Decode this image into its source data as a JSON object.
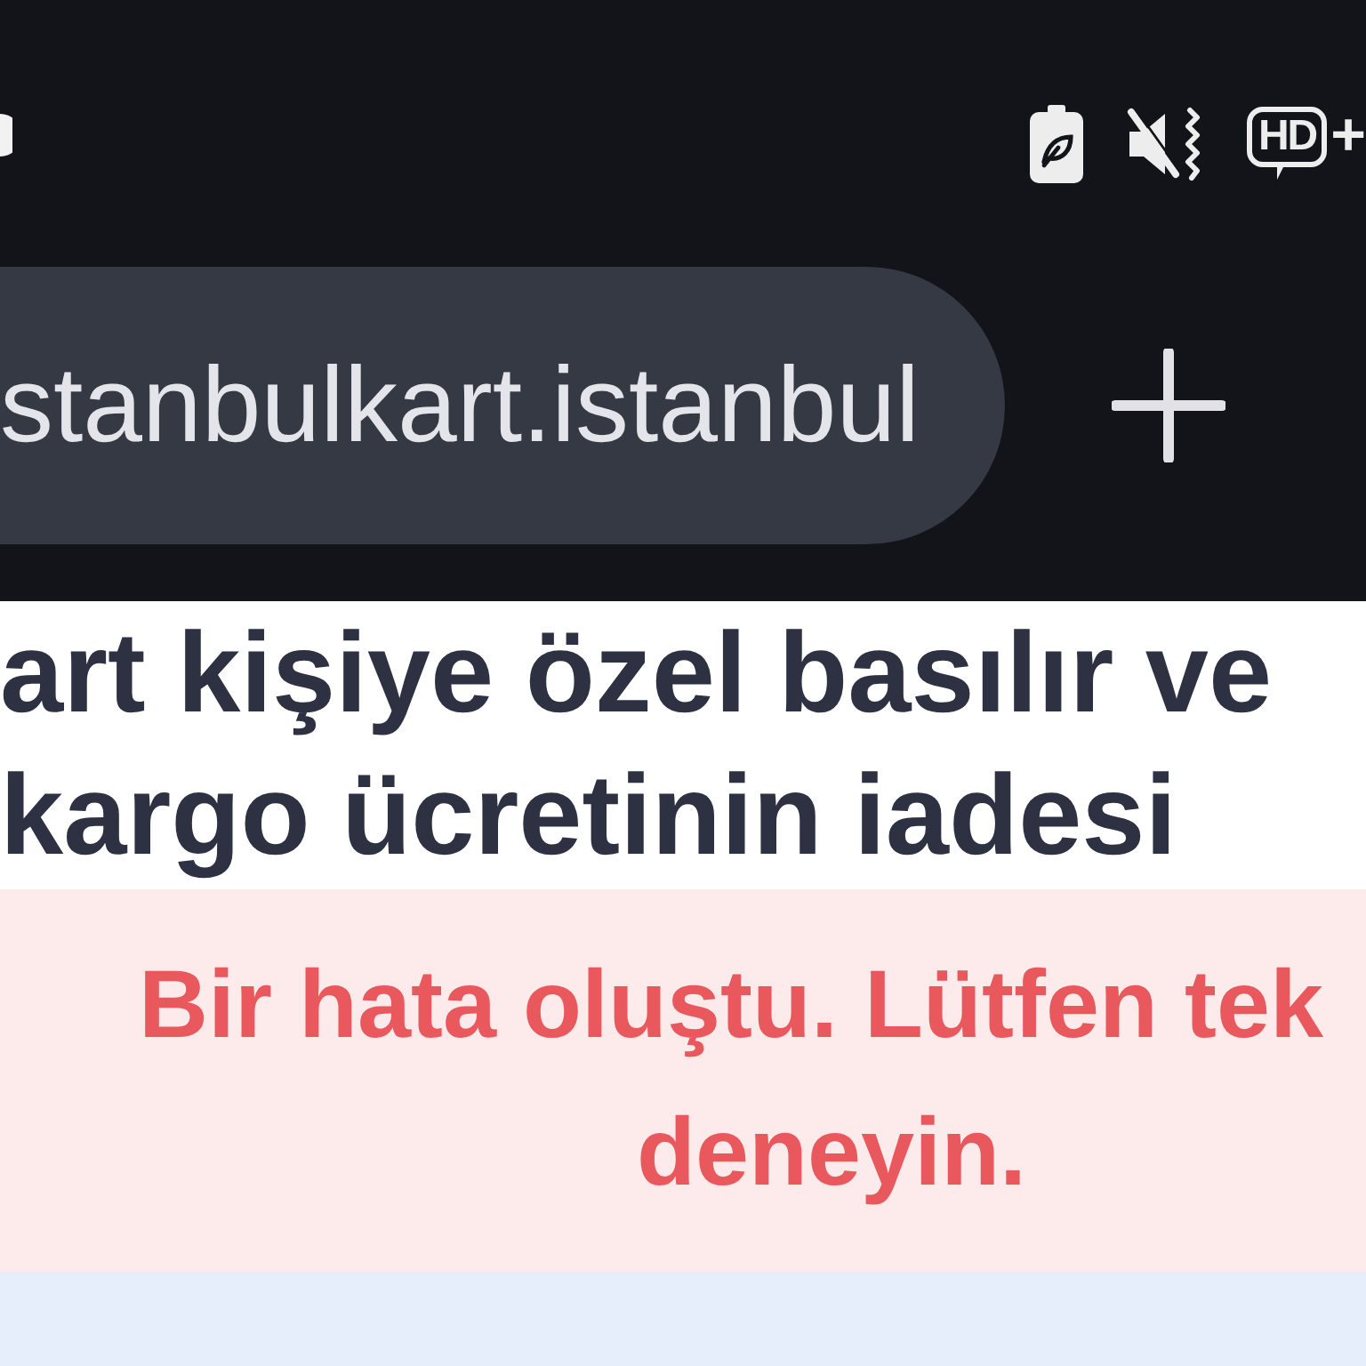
{
  "status_bar": {
    "hd_badge": {
      "text": "HD",
      "suffix": "+"
    }
  },
  "address_bar": {
    "url": "stanbulkart.istanbul"
  },
  "page": {
    "heading_lines": [
      "art kişiye özel basılır ve",
      "kargo ücretinin iadesi"
    ],
    "error_message": {
      "lines": [
        "Bir hata oluştu. Lütfen tek",
        "deneyin."
      ]
    }
  }
}
